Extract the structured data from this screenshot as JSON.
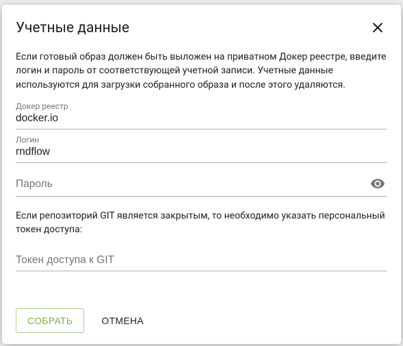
{
  "dialog": {
    "title": "Учетные данные",
    "desc1": "Если готовый образ должен быть выложен на приватном Докер реестре, введите логин и пароль от соответствующей учетной записи. Учетные данные используются для загрузки собранного образа и после этого удаляются.",
    "desc2": "Если репозиторий GIT является закрытым, то необходимо указать персональный токен доступа:"
  },
  "fields": {
    "registry": {
      "label": "Докер реестр",
      "value": "docker.io"
    },
    "login": {
      "label": "Логин",
      "value": "rndflow"
    },
    "password": {
      "placeholder": "Пароль",
      "value": ""
    },
    "gitToken": {
      "placeholder": "Токен доступа к GIT",
      "value": ""
    }
  },
  "actions": {
    "submit": "СОБРАТЬ",
    "cancel": "ОТМЕНА"
  },
  "colors": {
    "accent": "#7cb342"
  }
}
